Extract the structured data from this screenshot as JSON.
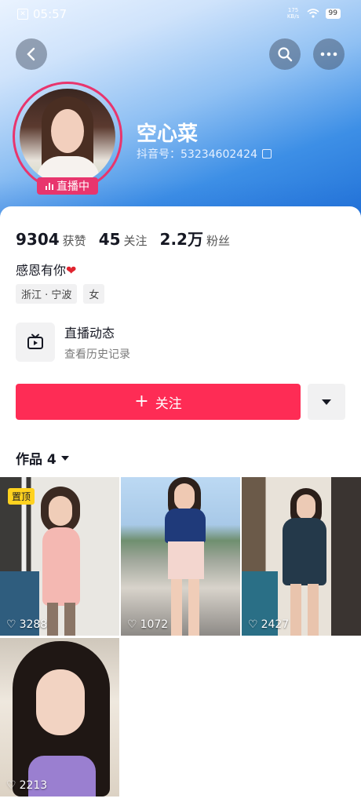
{
  "status_bar": {
    "time": "05:57",
    "net_speed": "175 KB/s",
    "battery": "99"
  },
  "profile": {
    "name": "空心菜",
    "douyin_id": "抖音号：53234602424",
    "live_badge": "直播中"
  },
  "stats": [
    {
      "value": "9304",
      "label": "获赞"
    },
    {
      "value": "45",
      "label": "关注"
    },
    {
      "value": "2.2万",
      "label": "粉丝"
    }
  ],
  "bio": "感恩有你",
  "tags": [
    "浙江 · 宁波",
    "女"
  ],
  "live_dynamic": {
    "title": "直播动态",
    "subtitle": "查看历史记录"
  },
  "follow_button": {
    "label": "关注"
  },
  "works_tab": {
    "label": "作品 4"
  },
  "videos": [
    {
      "likes": "3288",
      "pinned_label": "置顶"
    },
    {
      "likes": "1072"
    },
    {
      "likes": "2427"
    },
    {
      "likes": "2213"
    }
  ],
  "colors": {
    "accent": "#fe2c55",
    "live": "#e8356d",
    "header_blue": "#3d8fe6"
  }
}
